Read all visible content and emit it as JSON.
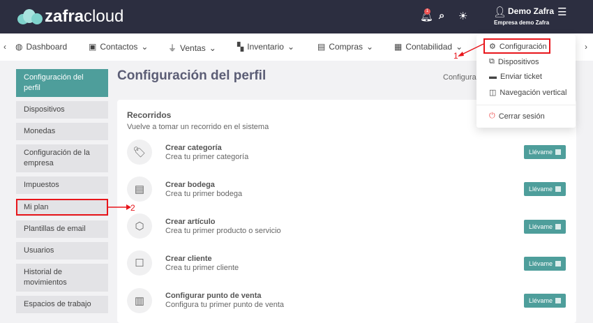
{
  "header": {
    "logo_bold": "zafra",
    "logo_light": "cloud",
    "notification_count": "1",
    "user_name": "Demo Zafra",
    "company": "Empresa demo Zafra"
  },
  "nav": {
    "items": [
      "Dashboard",
      "Contactos",
      "Ventas",
      "Inventario",
      "Compras",
      "Contabilidad"
    ]
  },
  "dropdown": {
    "items": [
      "Configuración",
      "Dispositivos",
      "Enviar ticket",
      "Navegación vertical"
    ],
    "logout": "Cerrar sesión"
  },
  "sidebar": {
    "items": [
      "Configuración del perfil",
      "Dispositivos",
      "Monedas",
      "Configuración de la empresa",
      "Impuestos",
      "Mi plan",
      "Plantillas de email",
      "Usuarios",
      "Historial de movimientos",
      "Espacios de trabajo"
    ]
  },
  "main": {
    "title": "Configuración del perfil",
    "breadcrumb": "Configura",
    "section_title": "Recorridos",
    "section_sub": "Vuelve a tomar un recorrido en el sistema",
    "button_label": "Llévame",
    "rows": [
      {
        "title": "Crear categoría",
        "sub": "Crea tu primer categoría"
      },
      {
        "title": "Crear bodega",
        "sub": "Crea tu primer bodega"
      },
      {
        "title": "Crear artículo",
        "sub": "Crea tu primer producto o servicio"
      },
      {
        "title": "Crear cliente",
        "sub": "Crea tu primer cliente"
      },
      {
        "title": "Configurar punto de venta",
        "sub": "Configura tu primer punto de venta"
      }
    ]
  },
  "annotations": {
    "a1": "1",
    "a2": "2"
  }
}
